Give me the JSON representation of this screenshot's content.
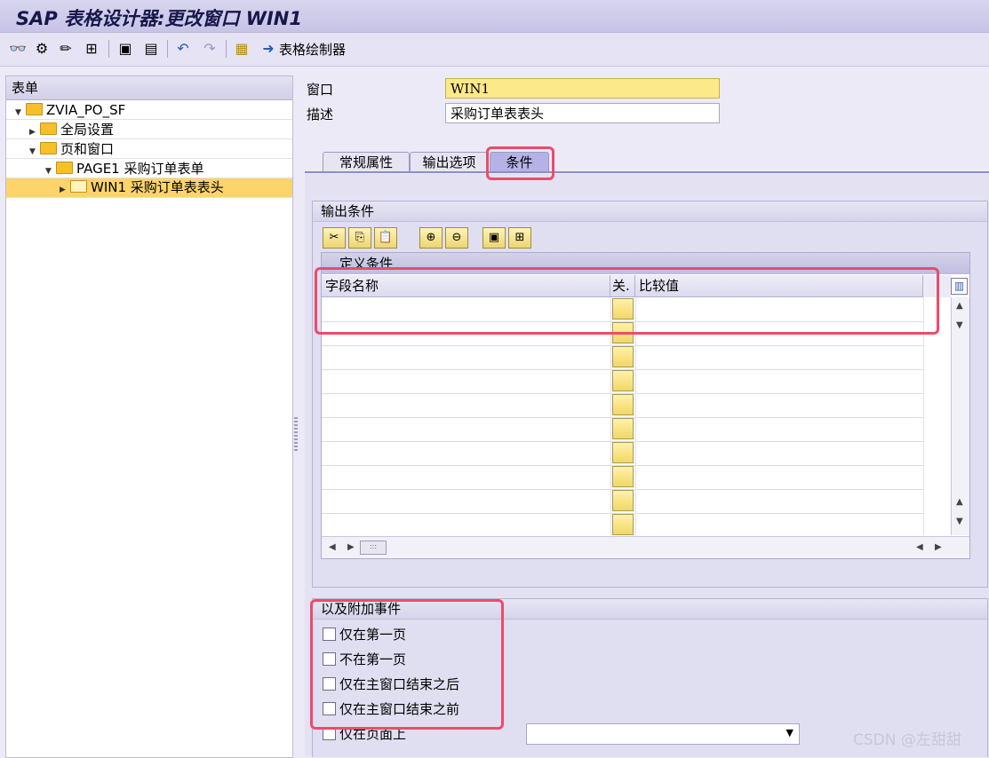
{
  "window": {
    "title": "SAP 表格设计器:更改窗口 WIN1"
  },
  "toolbar": {
    "form_painter_label": "表格绘制器"
  },
  "tree": {
    "header": "表单",
    "items": [
      {
        "label": "ZVIA_PO_SF",
        "expanded": true
      },
      {
        "label": "全局设置",
        "expanded": false
      },
      {
        "label": "页和窗口",
        "expanded": true
      },
      {
        "label": "PAGE1 采购订单表单",
        "expanded": true
      },
      {
        "label": "WIN1 采购订单表表头",
        "selected": true
      }
    ]
  },
  "form": {
    "window_label": "窗口",
    "window_value": "WIN1",
    "desc_label": "描述",
    "desc_value": "采购订单表表头"
  },
  "tabs": [
    {
      "label": "常规属性"
    },
    {
      "label": "输出选项"
    },
    {
      "label": "条件",
      "active": true
    }
  ],
  "output_conditions": {
    "group_title": "输出条件",
    "table_title": "定义条件",
    "columns": [
      "字段名称",
      "关.",
      "比较值"
    ],
    "row_count": 10
  },
  "events": {
    "group_title": "以及附加事件",
    "options": [
      {
        "label": "仅在第一页",
        "checked": false
      },
      {
        "label": "不在第一页",
        "checked": false
      },
      {
        "label": "仅在主窗口结束之后",
        "checked": false
      },
      {
        "label": "仅在主窗口结束之前",
        "checked": false
      },
      {
        "label": "仅在页面上",
        "checked": false
      }
    ],
    "page_select_value": ""
  },
  "watermark": "CSDN @左甜甜",
  "colors": {
    "highlight": "#ef4a6a",
    "required_field": "#fbe98a",
    "selected_tree": "#fbd46b"
  }
}
